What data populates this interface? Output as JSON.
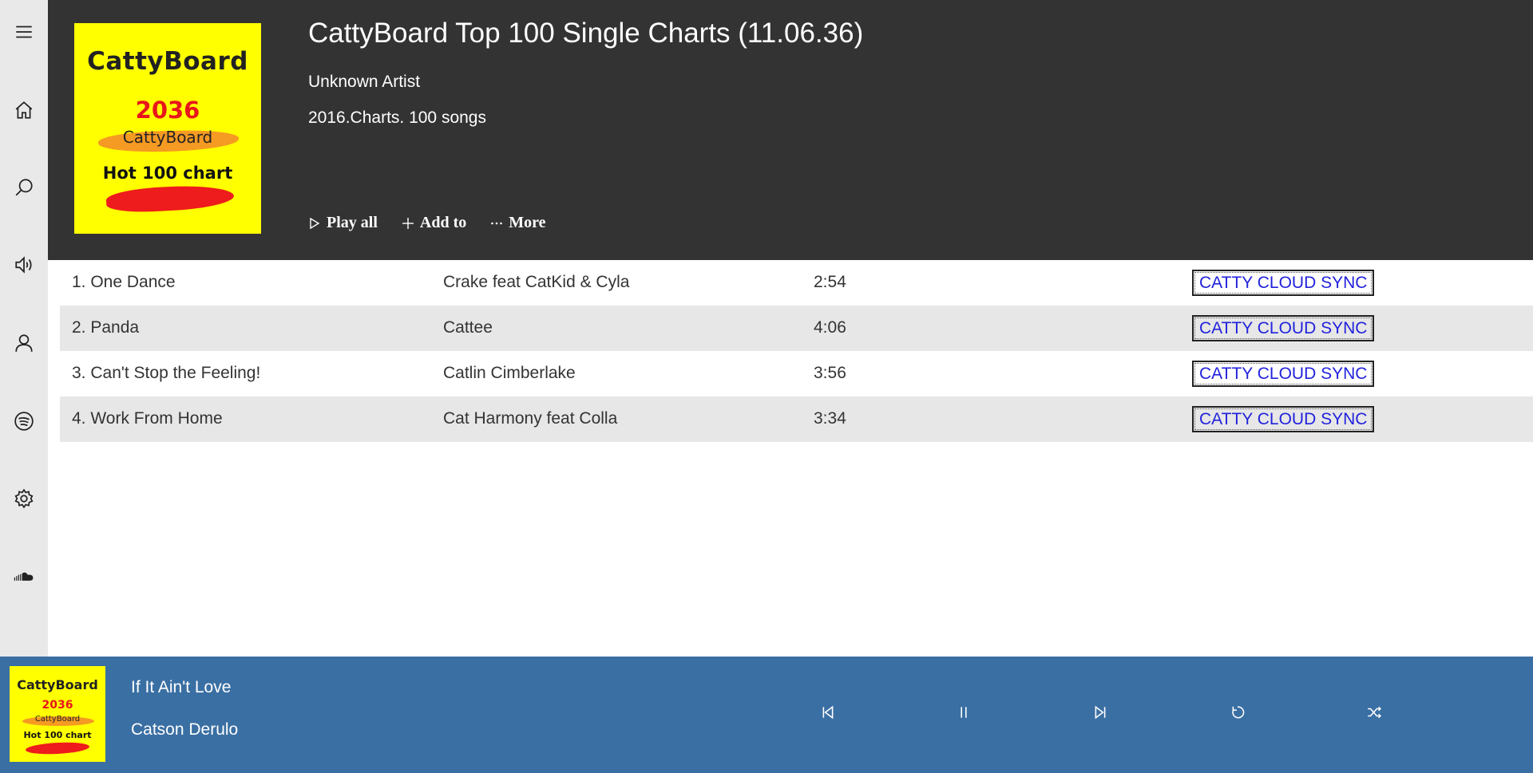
{
  "sidebar": {
    "items": [
      {
        "name": "menu-icon"
      },
      {
        "name": "home-icon"
      },
      {
        "name": "search-icon"
      },
      {
        "name": "volume-icon"
      },
      {
        "name": "user-icon"
      },
      {
        "name": "spotify-icon"
      },
      {
        "name": "gear-icon"
      },
      {
        "name": "soundcloud-icon"
      }
    ]
  },
  "album": {
    "title": "CattyBoard Top 100 Single Charts (11.06.36)",
    "artist": "Unknown Artist",
    "meta": "2016.Charts. 100 songs",
    "cover": {
      "brand": "CattyBoard",
      "year": "2036",
      "sub": "CattyBoard",
      "tagline": "Hot 100 chart"
    }
  },
  "actions": {
    "play_all": "Play all",
    "add_to": "Add to",
    "more": "More"
  },
  "tracks": [
    {
      "title": "1. One Dance",
      "artist": "Crake feat CatKid & Cyla",
      "duration": "2:54",
      "sync": "CATTY CLOUD SYNC"
    },
    {
      "title": "2. Panda",
      "artist": "Cattee",
      "duration": "4:06",
      "sync": "CATTY CLOUD SYNC"
    },
    {
      "title": "3. Can't Stop the Feeling!",
      "artist": "Catlin Cimberlake",
      "duration": "3:56",
      "sync": "CATTY CLOUD SYNC"
    },
    {
      "title": "4. Work From Home",
      "artist": "Cat Harmony feat Colla",
      "duration": "3:34",
      "sync": "CATTY CLOUD SYNC"
    }
  ],
  "player": {
    "title": "If It Ain't Love",
    "artist": "Catson Derulo"
  },
  "colors": {
    "header_bg": "#333333",
    "sidebar_bg": "#e8e9e8",
    "player_bg": "#3a6fa3",
    "row_alt": "#e6e7e6",
    "link": "#2222dd",
    "cover_yellow": "#ffff00"
  }
}
